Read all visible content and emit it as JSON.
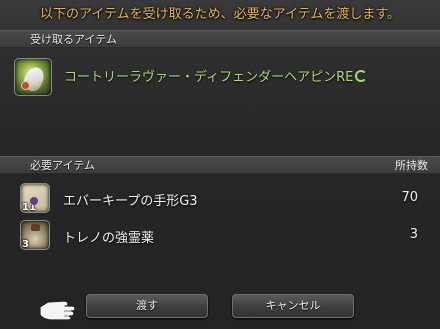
{
  "header": {
    "message": "以下のアイテムを受け取るため、必要なアイテムを渡します。"
  },
  "receive_section": {
    "title": "受け取るアイテム",
    "item": {
      "name": "コートリーラヴァー・ディフェンダーヘアピンRE",
      "quality_icon": "hq-icon"
    }
  },
  "required_section": {
    "title": "必要アイテム",
    "count_header": "所持数",
    "items": [
      {
        "name": "エバーキープの手形G3",
        "qty": "70",
        "stack": "11",
        "icon": "scroll-icon"
      },
      {
        "name": "トレノの強霊薬",
        "qty": "3",
        "stack": "3",
        "icon": "potion-icon"
      }
    ]
  },
  "buttons": {
    "ok": "渡す",
    "cancel": "キャンセル"
  },
  "colors": {
    "header_text": "#e3b45a",
    "item_name_green": "#a8d97a"
  }
}
